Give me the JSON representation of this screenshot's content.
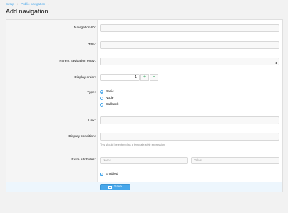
{
  "breadcrumb": {
    "items": [
      "Setup",
      "Public navigation"
    ],
    "sep": "›"
  },
  "page": {
    "title": "Add navigation"
  },
  "form": {
    "navigation_id": {
      "label": "Navigation ID:",
      "value": ""
    },
    "title": {
      "label": "Title:",
      "value": ""
    },
    "parent": {
      "label": "Parent navigation entry:",
      "value": ""
    },
    "display_order": {
      "label": "Display order:",
      "value": "1",
      "plus": "+",
      "minus": "−"
    },
    "type": {
      "label": "Type:",
      "options": [
        "Basic",
        "Node",
        "Callback"
      ],
      "selected": "Basic"
    },
    "link": {
      "label": "Link:",
      "value": ""
    },
    "display_condition": {
      "label": "Display condition:",
      "value": "",
      "hint": "This should be entered as a template-style expression."
    },
    "extra_attributes": {
      "label": "Extra attributes:",
      "name_placeholder": "Name",
      "value_placeholder": "Value"
    },
    "enabled": {
      "label": "Enabled",
      "checked": true
    }
  },
  "actions": {
    "save_label": "Save"
  },
  "colors": {
    "accent": "#47a7eb",
    "step_green": "#1e9e50"
  }
}
